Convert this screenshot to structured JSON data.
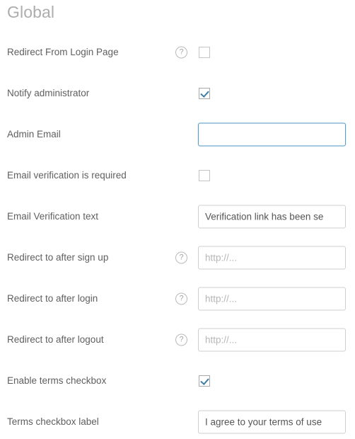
{
  "page": {
    "title": "Global",
    "accent_color": "#3d7ea6",
    "focus_border_color": "#5a9bc8",
    "label_color": "#5f5f5f",
    "title_color": "#adadad"
  },
  "help_icon_glyph": "?",
  "rows": [
    {
      "id": "redirect-from-login-page",
      "label": "Redirect From Login Page",
      "control": "checkbox",
      "help": true,
      "checked": false
    },
    {
      "id": "notify-administrator",
      "label": "Notify administrator",
      "control": "checkbox",
      "help": false,
      "checked": true
    },
    {
      "id": "admin-email",
      "label": "Admin Email",
      "control": "text",
      "help": false,
      "value": "",
      "placeholder": "",
      "focused": true
    },
    {
      "id": "email-verification-is-required",
      "label": "Email verification is required",
      "control": "checkbox",
      "help": false,
      "checked": false
    },
    {
      "id": "email-verification-text",
      "label": "Email Verification text",
      "control": "text",
      "help": false,
      "value": "Verification link has been se",
      "placeholder": "",
      "focused": false
    },
    {
      "id": "redirect-to-after-sign-up",
      "label": "Redirect to after sign up",
      "control": "text",
      "help": true,
      "value": "",
      "placeholder": "http://...",
      "focused": false
    },
    {
      "id": "redirect-to-after-login",
      "label": "Redirect to after login",
      "control": "text",
      "help": true,
      "value": "",
      "placeholder": "http://...",
      "focused": false
    },
    {
      "id": "redirect-to-after-logout",
      "label": "Redirect to after logout",
      "control": "text",
      "help": true,
      "value": "",
      "placeholder": "http://...",
      "focused": false
    },
    {
      "id": "enable-terms-checkbox",
      "label": "Enable terms checkbox",
      "control": "checkbox",
      "help": false,
      "checked": true
    },
    {
      "id": "terms-checkbox-label",
      "label": "Terms checkbox label",
      "control": "text",
      "help": false,
      "value": "I agree to your terms of use",
      "placeholder": "",
      "focused": false
    }
  ]
}
